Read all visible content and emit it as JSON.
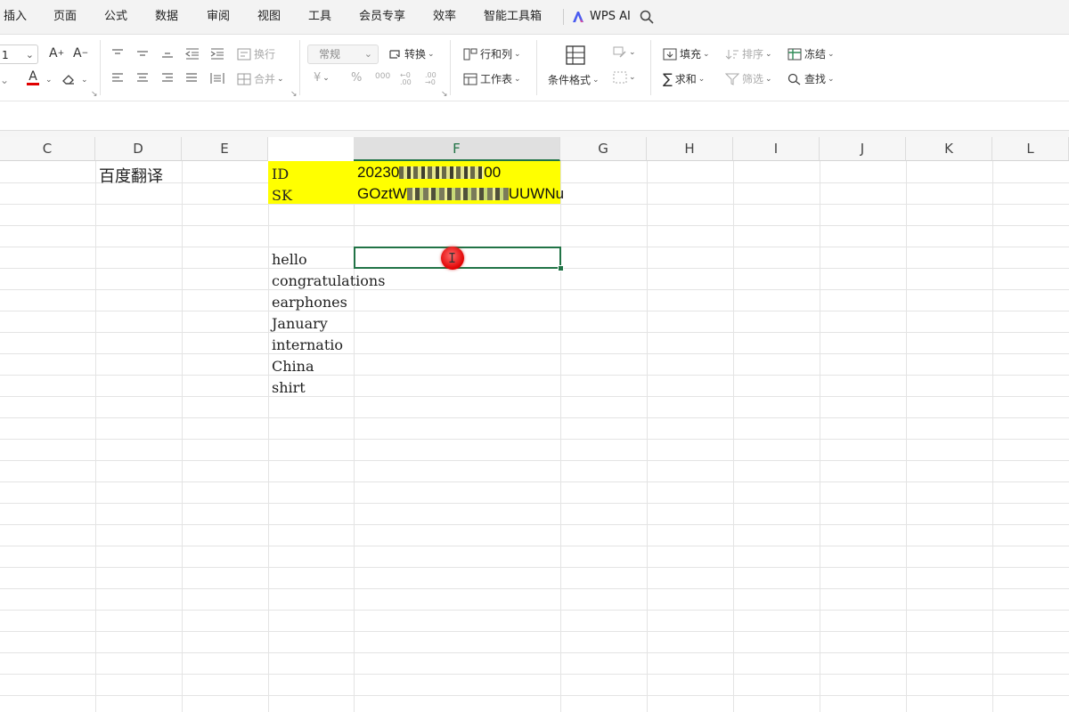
{
  "menu": {
    "items": [
      "插入",
      "页面",
      "公式",
      "数据",
      "审阅",
      "视图",
      "工具",
      "会员专享",
      "效率",
      "智能工具箱"
    ],
    "wps_ai": "WPS AI"
  },
  "ribbon": {
    "font_size": "1",
    "wrap": "换行",
    "merge": "合并",
    "number_format": "常规",
    "convert": "转换",
    "rows_cols": "行和列",
    "worksheet": "工作表",
    "cond_format": "条件格式",
    "fill": "填充",
    "sort": "排序",
    "freeze": "冻结",
    "sum": "求和",
    "filter": "筛选",
    "find": "查找",
    "font_color": "#e00000",
    "number_symbols": {
      "currency": "¥",
      "percent": "%",
      "thousands": "000",
      "dec_add": "←0 .00",
      "dec_remove": ".00 →0"
    }
  },
  "grid": {
    "columns": [
      "C",
      "D",
      "E",
      "F",
      "G",
      "H",
      "I",
      "J",
      "K",
      "L"
    ],
    "active_column": "F",
    "c_label": "百度翻译",
    "id_label": "ID",
    "id_value_prefix": "20230",
    "id_value_suffix": "00",
    "sk_label": "SK",
    "sk_value_prefix": "GOztW",
    "sk_value_suffix": "UUWNu",
    "words": [
      "hello",
      "congratulations",
      "earphones",
      "January",
      "internatio",
      "China",
      "shirt"
    ],
    "highlight_color": "#ffff00",
    "selection_color": "#217346"
  }
}
